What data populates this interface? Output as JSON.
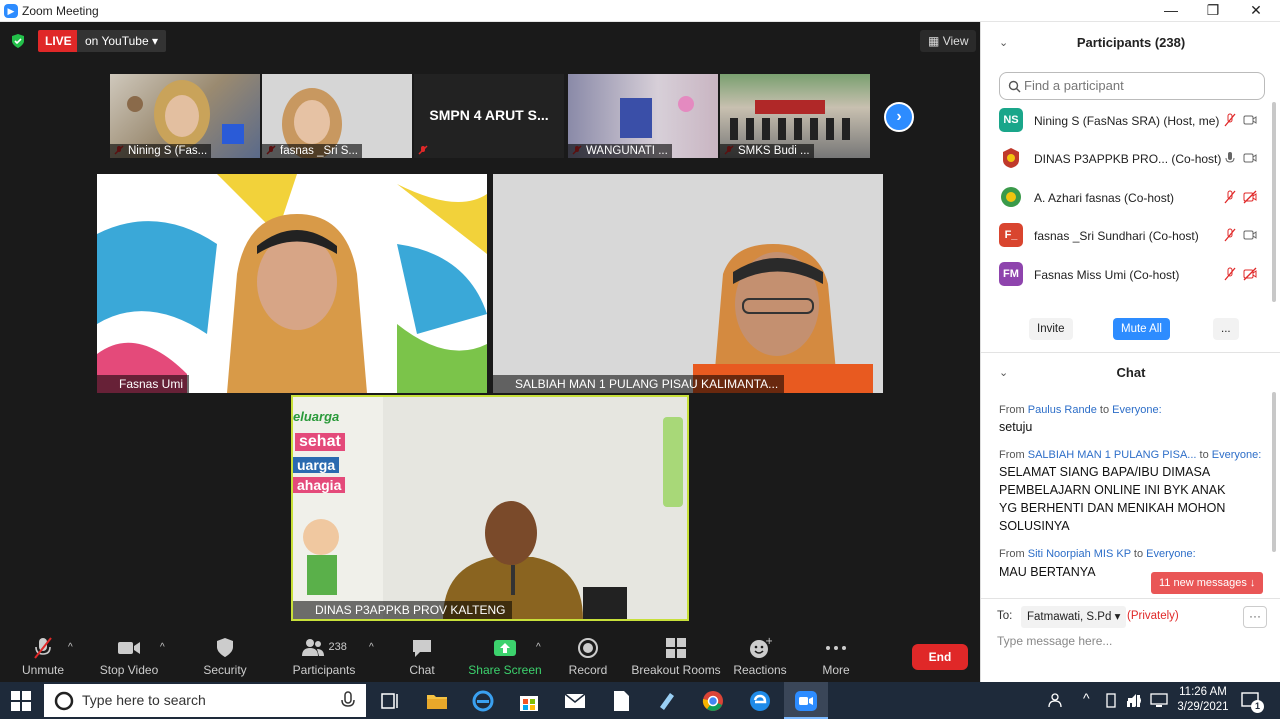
{
  "window": {
    "title": "Zoom Meeting",
    "minimize": "—",
    "restore": "❐",
    "close": "✕"
  },
  "top": {
    "live": "LIVE",
    "on_youtube": "on YouTube",
    "view": "View"
  },
  "thumbnails": [
    {
      "name": "Nining S (Fas...",
      "muted": true
    },
    {
      "name": "fasnas _Sri S...",
      "muted": true
    },
    {
      "name": "",
      "big_label": "SMPN 4 ARUT S...",
      "muted": true
    },
    {
      "name": "WANGUNATI ...",
      "muted": true
    },
    {
      "name": "SMKS Budi ...",
      "muted": true
    }
  ],
  "tiles": [
    {
      "name": "Fasnas Umi"
    },
    {
      "name": "SALBIAH MAN 1 PULANG PISAU KALIMANTA..."
    },
    {
      "name": "DINAS P3APPKB PROV KALTENG"
    }
  ],
  "banner_text": {
    "line1": "eluarga",
    "line2": "sehat",
    "line3": "uarga",
    "line4": "ahagia"
  },
  "toolbar": {
    "unmute": "Unmute",
    "stop_video": "Stop Video",
    "security": "Security",
    "participants": "Participants",
    "participants_count": "238",
    "chat": "Chat",
    "share_screen": "Share Screen",
    "record": "Record",
    "breakout": "Breakout Rooms",
    "reactions": "Reactions",
    "more": "More",
    "end": "End"
  },
  "participants_panel": {
    "title": "Participants (238)",
    "search_placeholder": "Find a participant",
    "list": [
      {
        "initials": "NS",
        "name": "Nining S (FasNas SRA) (Host, me)",
        "color": "#1aa68a"
      },
      {
        "initials": "",
        "name": "DINAS P3APPKB PRO...   (Co-host)",
        "color": "#c0392b"
      },
      {
        "initials": "",
        "name": "A. Azhari fasnas (Co-host)",
        "color": "#3a9a4a"
      },
      {
        "initials": "F_",
        "name": "fasnas _Sri Sundhari (Co-host)",
        "color": "#d9452f"
      },
      {
        "initials": "FM",
        "name": "Fasnas Miss Umi (Co-host)",
        "color": "#8e44ad"
      }
    ],
    "invite": "Invite",
    "mute_all": "Mute All",
    "more": "..."
  },
  "chat_panel": {
    "title": "Chat",
    "messages": [
      {
        "from_label": "From",
        "sender": "Paulus Rande",
        "to_label": "to",
        "recipient": "Everyone:",
        "text": "setuju"
      },
      {
        "from_label": "From",
        "sender": "SALBIAH MAN 1 PULANG PISA...",
        "to_label": "to",
        "recipient": "Everyone:",
        "text": "SELAMAT SIANG BAPA/IBU DIMASA PEMBELAJARN ONLINE INI BYK ANAK YG BERHENTI DAN MENIKAH MOHON SOLUSINYA"
      },
      {
        "from_label": "From",
        "sender": "Siti Noorpiah MIS KP",
        "to_label": "to",
        "recipient": "Everyone:",
        "text": "MAU BERTANYA"
      }
    ],
    "new_messages": "11 new messages ↓",
    "to_label": "To:",
    "to_value": "Fatmawati, S.Pd",
    "privately": "(Privately)",
    "input_placeholder": "Type message here...",
    "more": "···"
  },
  "taskbar": {
    "search_placeholder": "Type here to search",
    "time": "11:26 AM",
    "date": "3/29/2021",
    "notif": "1"
  }
}
